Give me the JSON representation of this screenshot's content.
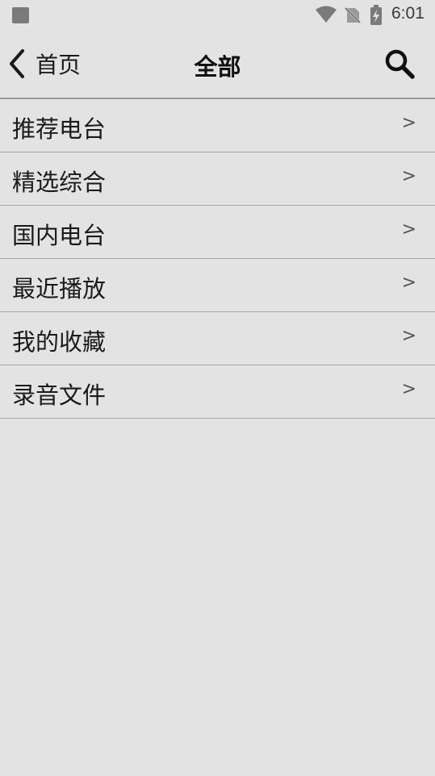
{
  "status_bar": {
    "time": "6:01",
    "icons": [
      "app-notification-icon",
      "wifi-icon",
      "no-sim-icon",
      "battery-charging-icon"
    ]
  },
  "header": {
    "back_label": "首页",
    "title": "全部",
    "back_icon": "chevron-left-icon",
    "search_icon": "search-icon"
  },
  "menu": {
    "items": [
      {
        "label": "推荐电台",
        "arrow": ">"
      },
      {
        "label": "精选综合",
        "arrow": ">"
      },
      {
        "label": "国内电台",
        "arrow": ">"
      },
      {
        "label": "最近播放",
        "arrow": ">"
      },
      {
        "label": "我的收藏",
        "arrow": ">"
      },
      {
        "label": "录音文件",
        "arrow": ">"
      }
    ]
  },
  "colors": {
    "background": "#e3e3e3",
    "divider": "#a8a8a8",
    "text": "#1a1a1a"
  }
}
